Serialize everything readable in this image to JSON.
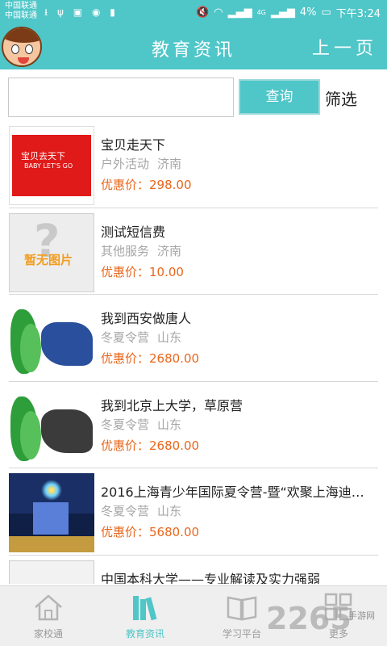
{
  "status_bar": {
    "carrier_1": "中国联通",
    "carrier_2": "中国联通",
    "battery": "4%",
    "time": "下午3:24",
    "signal_label": "4G"
  },
  "header": {
    "title": "教育资讯",
    "back_label": "上一页"
  },
  "search": {
    "value": "",
    "placeholder": "",
    "button_label": "查询",
    "filter_label": "筛选"
  },
  "items": [
    {
      "title": "宝贝走天下",
      "category": "户外活动",
      "city": "济南",
      "price": "优惠价：298.00",
      "thumb_text": "宝贝去天下",
      "thumb_sub": "BABY LET'S GO"
    },
    {
      "title": "测试短信费",
      "category": "其他服务",
      "city": "济南",
      "price": "优惠价：10.00",
      "thumb_text": "暂无图片"
    },
    {
      "title": "我到西安做唐人",
      "category": "冬夏令营",
      "city": "山东",
      "price": "优惠价：2680.00"
    },
    {
      "title": "我到北京上大学，草原营",
      "category": "冬夏令营",
      "city": "山东",
      "price": "优惠价：2680.00"
    },
    {
      "title": "2016上海青少年国际夏令营-暨“欢聚上海迪…",
      "category": "冬夏令营",
      "city": "山东",
      "price": "优惠价：5680.00"
    },
    {
      "title": "中国本科大学——专业解读及实力强弱",
      "category": "",
      "city": "",
      "price": ""
    }
  ],
  "tabs": [
    {
      "label": "家校通",
      "icon": "home-icon"
    },
    {
      "label": "教育资讯",
      "icon": "books-icon",
      "active": true
    },
    {
      "label": "学习平台",
      "icon": "open-book-icon"
    },
    {
      "label": "更多",
      "icon": "grid-icon"
    }
  ],
  "watermark": {
    "brand": "2265",
    "tag": "手游网"
  },
  "colors": {
    "accent": "#4fc6c8",
    "price": "#e8671b"
  }
}
